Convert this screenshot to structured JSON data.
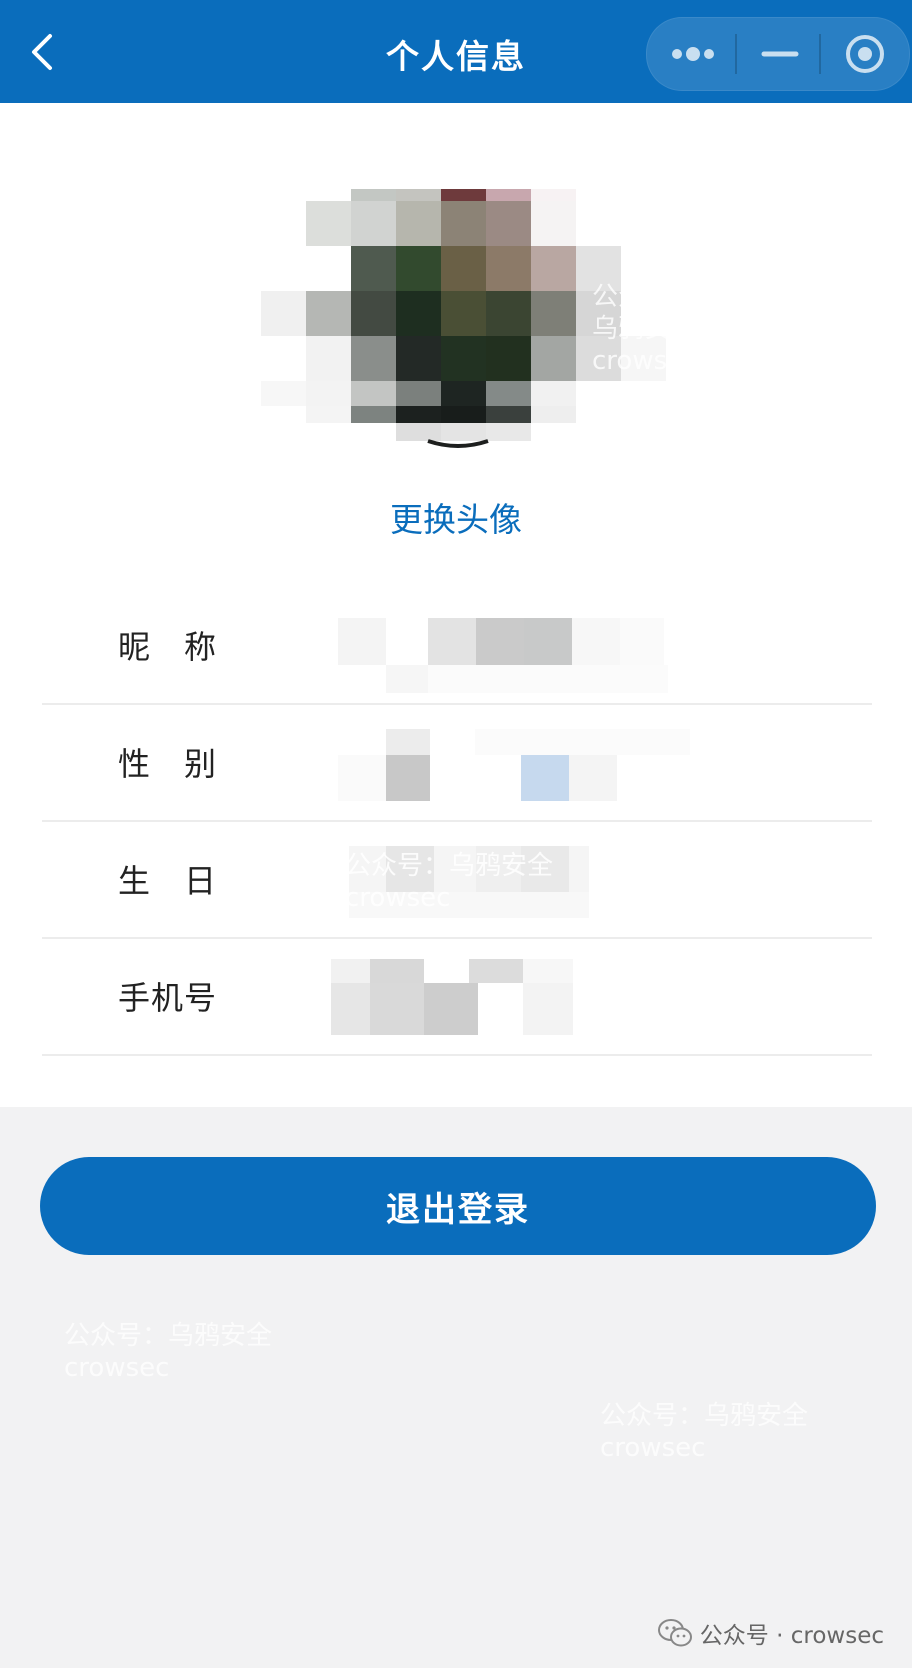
{
  "header": {
    "title": "个人信息",
    "back_icon": "chevron-left-icon",
    "capsule": {
      "more_icon": "more-dots-icon",
      "minimize_icon": "minimize-icon",
      "close_icon": "target-circle-icon"
    }
  },
  "profile": {
    "avatar_pixelated": true,
    "change_avatar_label": "更换头像"
  },
  "fields": [
    {
      "label": "昵　称",
      "value_pixelated": true
    },
    {
      "label": "性　别",
      "value_pixelated": true
    },
    {
      "label": "生　日",
      "value_pixelated": true
    },
    {
      "label": "手机号",
      "value_pixelated": true
    }
  ],
  "logout_label": "退出登录",
  "watermarks": {
    "line1": "公众号：乌鸦安全",
    "line2": "crowsec"
  },
  "footer": {
    "icon": "wechat-icon",
    "text": "公众号 · crowsec"
  },
  "colors": {
    "primary": "#0a6dbc",
    "background": "#f2f2f3"
  }
}
